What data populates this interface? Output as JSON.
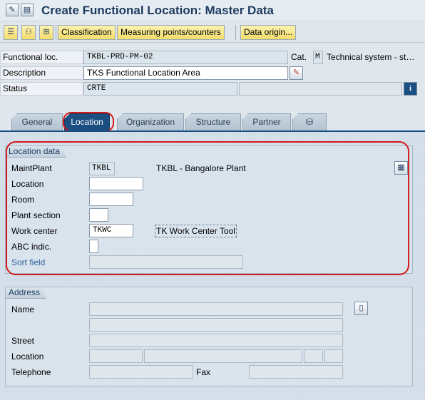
{
  "window": {
    "title": "Create Functional Location: Master Data"
  },
  "toolbar": {
    "classification_label": "Classification",
    "measuring_label": "Measuring points/counters",
    "data_origin_label": "Data origin..."
  },
  "header": {
    "functional_loc_label": "Functional loc.",
    "functional_loc_value": "TKBL-PRD-PM-02",
    "cat_label": "Cat.",
    "cat_value": "M",
    "cat_text": "Technical system - st…",
    "description_label": "Description",
    "description_value": "TKS Functional Location Area",
    "status_label": "Status",
    "status_value": "CRTE"
  },
  "tabs": [
    {
      "label": "General"
    },
    {
      "label": "Location"
    },
    {
      "label": "Organization"
    },
    {
      "label": "Structure"
    },
    {
      "label": "Partner"
    }
  ],
  "location_data": {
    "group_title": "Location data",
    "maintplant_label": "MaintPlant",
    "maintplant_value": "TKBL",
    "maintplant_text": "TKBL - Bangalore Plant",
    "location_label": "Location",
    "location_value": "",
    "room_label": "Room",
    "room_value": "",
    "plant_section_label": "Plant section",
    "plant_section_value": "",
    "work_center_label": "Work center",
    "work_center_value": "TKWC",
    "work_center_text": "TK Work Center Tool",
    "abc_label": "ABC indic.",
    "abc_value": "",
    "sort_field_label": "Sort field",
    "sort_field_value": ""
  },
  "address": {
    "group_title": "Address",
    "name_label": "Name",
    "street_label": "Street",
    "location_label": "Location",
    "telephone_label": "Telephone",
    "fax_label": "Fax"
  },
  "colors": {
    "accent": "#1b4f82",
    "highlight_circle": "#d41a1a",
    "button_yellow": "#f2dc6a"
  }
}
